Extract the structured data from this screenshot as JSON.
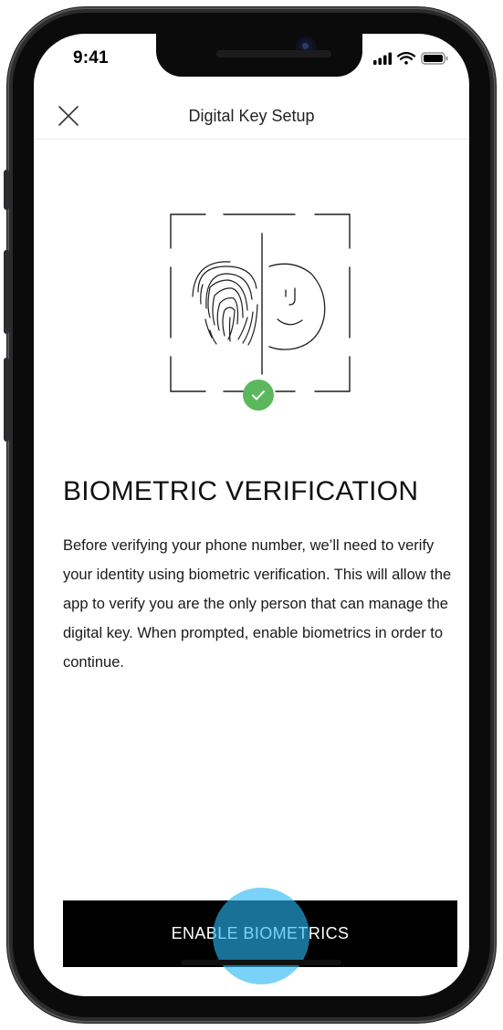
{
  "status_bar": {
    "time": "9:41",
    "icons": [
      "signal-bars-icon",
      "wifi-icon",
      "battery-icon"
    ]
  },
  "header": {
    "close_icon": "close-x-icon",
    "title": "Digital Key Setup"
  },
  "illustration": {
    "icons": [
      "fingerprint-icon",
      "face-id-icon",
      "checkmark-icon"
    ],
    "check_color": "#5cb85c"
  },
  "content": {
    "heading": "BIOMETRIC VERIFICATION",
    "body": "Before verifying your phone number, we’ll need to verify your identity using biometric verification. This will allow the app to verify you are the only person that can manage the digital key. When prompted, enable biometrics in order to continue."
  },
  "footer": {
    "button_label": "ENABLE BIOMETRICS",
    "button_color": "#000000",
    "tap_indicator_color": "#29b6f6"
  }
}
